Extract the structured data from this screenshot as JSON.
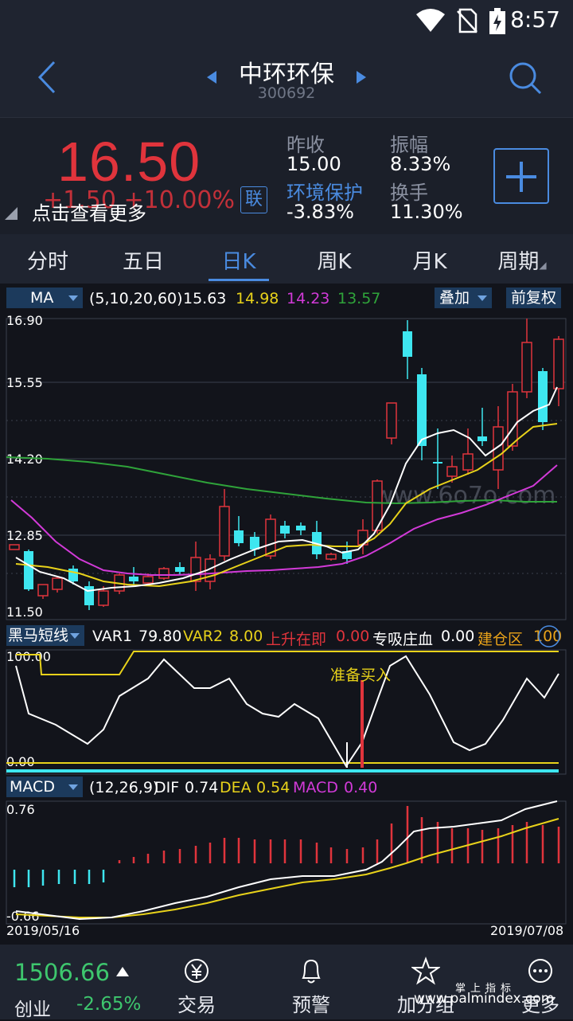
{
  "status": {
    "time": "8:57"
  },
  "header": {
    "title": "中环环保",
    "code": "300692"
  },
  "quote": {
    "price": "16.50",
    "change": "+1.50  +10.00%",
    "tip": "点击查看更多",
    "lian": "联",
    "prev_close_label": "昨收",
    "prev_close": "15.00",
    "amplitude_label": "振幅",
    "amplitude": "8.33%",
    "sector_label": "环境保护",
    "sector_change": "-3.83%",
    "turnover_label": "换手",
    "turnover": "11.30%"
  },
  "tabs": [
    "分时",
    "五日",
    "日K",
    "周K",
    "月K",
    "周期"
  ],
  "ma": {
    "selector": "MA",
    "params": "(5,10,20,60)",
    "v5": "15.63",
    "v10": "14.98",
    "v20": "14.23",
    "v60": "13.57",
    "overlay": "叠加",
    "adjust": "前复权",
    "axis": [
      "16.90",
      "15.55",
      "14.20",
      "12.85",
      "11.50"
    ],
    "watermark": "www.6o7o.com"
  },
  "hm": {
    "selector": "黑马短线",
    "var1_label": "VAR1",
    "var1": "79.80",
    "var2_label": "VAR2",
    "var2": "8.00",
    "rise_label": "上升在即",
    "rise": "0.00",
    "absorb_label": "专吸庄血",
    "absorb": "0.00",
    "build_label": "建仓区",
    "build": "100",
    "axis_top": "100.00",
    "axis_bottom": "0.00",
    "note": "准备买入"
  },
  "macd": {
    "selector": "MACD",
    "params": "(12,26,9)",
    "dif_label": "DIF",
    "dif": "0.74",
    "dea_label": "DEA",
    "dea": "0.54",
    "macd_label": "MACD",
    "macd": "0.40",
    "axis_top": "0.76",
    "axis_bottom": "-0.66",
    "date_start": "2019/05/16",
    "date_end": "2019/07/08"
  },
  "bottom": {
    "index_value": "1506.66",
    "index_name": "创业",
    "index_change": "-2.65%",
    "nav": [
      "交易",
      "预警",
      "加分组",
      "更多"
    ],
    "watermark": "www.palmindex.com",
    "watermark_cn": "掌上指标"
  },
  "colors": {
    "up": "#e0343c",
    "down": "#3ee6f0",
    "ma5": "#ffffff",
    "ma10": "#e8d21a",
    "ma20": "#d23ad8",
    "ma60": "#2fa33a",
    "accent": "#4a8be0"
  }
}
